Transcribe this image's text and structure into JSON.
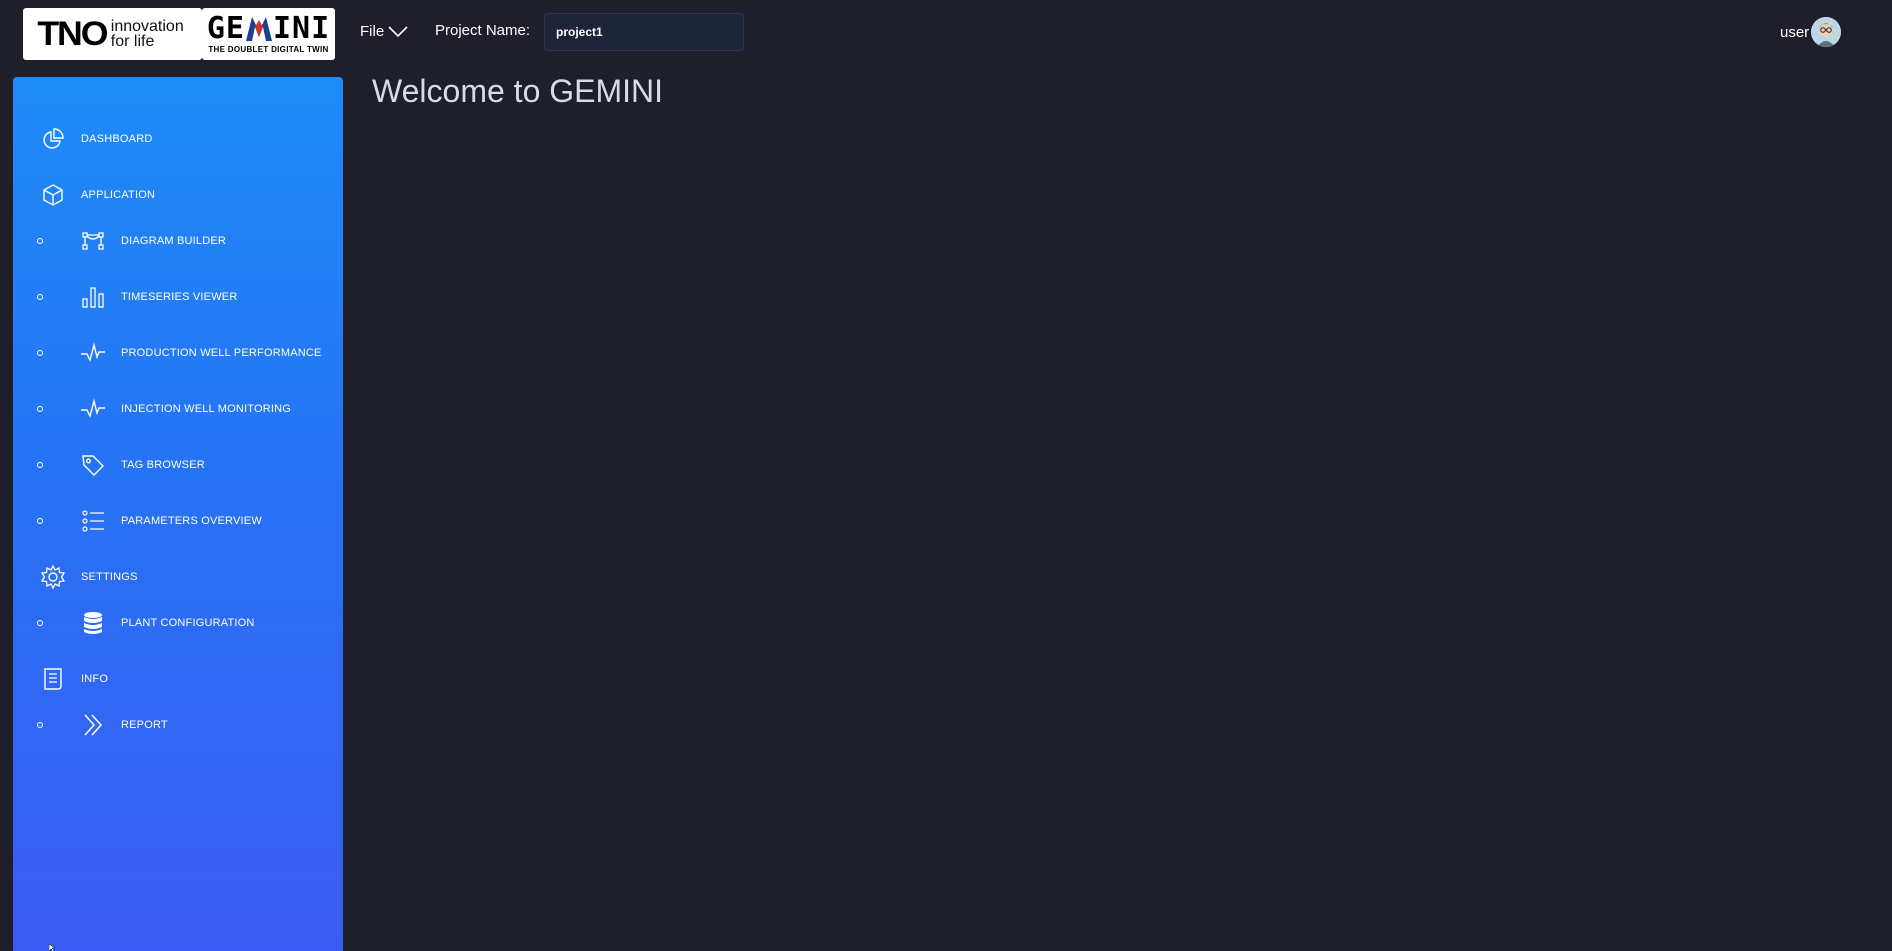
{
  "header": {
    "tno_logo": {
      "mark": "TNO",
      "tagline_line1": "innovation",
      "tagline_line2": "for life"
    },
    "gemini_logo": {
      "word_left": "GE",
      "word_right": "INI",
      "subtitle": "THE DOUBLET DIGITAL TWIN"
    },
    "file_menu_label": "File",
    "project_label": "Project Name:",
    "project_value": "project1",
    "user_label": "user"
  },
  "sidebar": {
    "items": [
      {
        "label": "DASHBOARD",
        "icon": "pie-chart-icon"
      },
      {
        "label": "APPLICATION",
        "icon": "cube-icon"
      },
      {
        "label": "DIAGRAM BUILDER",
        "icon": "diagram-icon"
      },
      {
        "label": "TIMESERIES VIEWER",
        "icon": "bar-chart-icon"
      },
      {
        "label": "PRODUCTION WELL PERFORMANCE",
        "icon": "pulse-icon"
      },
      {
        "label": "INJECTION WELL MONITORING",
        "icon": "pulse-icon"
      },
      {
        "label": "TAG BROWSER",
        "icon": "tag-icon"
      },
      {
        "label": "PARAMETERS OVERVIEW",
        "icon": "list-icon"
      },
      {
        "label": "SETTINGS",
        "icon": "gear-icon"
      },
      {
        "label": "PLANT CONFIGURATION",
        "icon": "database-icon"
      },
      {
        "label": "INFO",
        "icon": "document-icon"
      },
      {
        "label": "REPORT",
        "icon": "chevrons-right-icon"
      }
    ]
  },
  "main": {
    "title": "Welcome to GEMINI"
  },
  "colors": {
    "background": "#1f1f2b",
    "sidebar_top": "#1e8bf6",
    "sidebar_bottom": "#3b5cf2",
    "title_text": "#d7dbe6"
  }
}
